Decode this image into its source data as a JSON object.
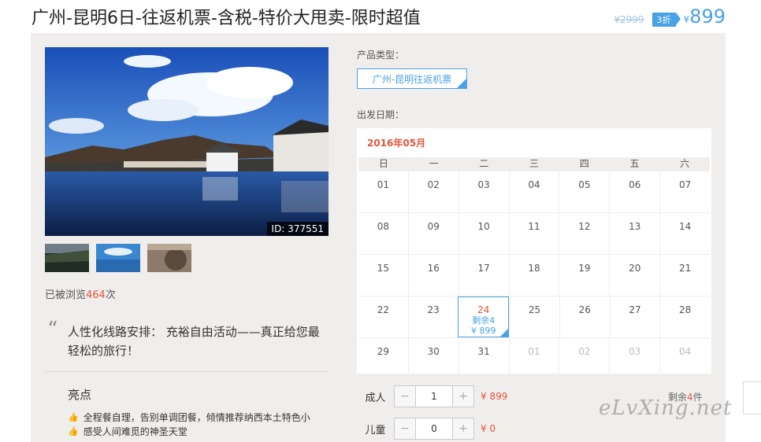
{
  "header": {
    "title": "广州-昆明6日-往返机票-含税-特价大甩卖-限时超值",
    "old_price": "¥2999",
    "discount": "3折",
    "currency": "¥",
    "price": "899"
  },
  "gallery": {
    "photo_id": "ID: 377551",
    "views_prefix": "已被浏览",
    "views_count": "464",
    "views_suffix": "次"
  },
  "quote": {
    "mark": "“",
    "text": "人性化线路安排： 充裕自由活动——真正给您最轻松的旅行！"
  },
  "highlights": {
    "title": "亮点",
    "items": [
      "全程餐自理，告别单调团餐，倾情推荐纳西本土特色小",
      "感受人间难觅的神圣天堂"
    ]
  },
  "product": {
    "type_label": "产品类型：",
    "type_value": "广州-昆明往返机票",
    "date_label": "出发日期："
  },
  "calendar": {
    "month": "2016年05月",
    "weekdays": [
      "日",
      "一",
      "二",
      "三",
      "四",
      "五",
      "六"
    ],
    "rows": [
      [
        "01",
        "02",
        "03",
        "04",
        "05",
        "06",
        "07"
      ],
      [
        "08",
        "09",
        "10",
        "11",
        "12",
        "13",
        "14"
      ],
      [
        "15",
        "16",
        "17",
        "18",
        "19",
        "20",
        "21"
      ],
      [
        "22",
        "23",
        "24",
        "25",
        "26",
        "27",
        "28"
      ],
      [
        "29",
        "30",
        "31",
        "01",
        "02",
        "03",
        "04"
      ]
    ],
    "selected": {
      "day": "24",
      "remain": "剩余4",
      "price": "¥ 899"
    }
  },
  "quantity": {
    "adult_label": "成人",
    "adult_value": "1",
    "adult_price": "¥ 899",
    "child_label": "儿童",
    "child_value": "0",
    "child_price": "¥ 0",
    "minus": "−",
    "plus": "+",
    "remain_prefix": "剩余",
    "remain_count": "4",
    "remain_suffix": "件"
  },
  "watermark": "eLvXing.net",
  "colors": {
    "accent": "#4aa2e6",
    "price_red": "#e4553a",
    "panel": "#f0eeec"
  }
}
